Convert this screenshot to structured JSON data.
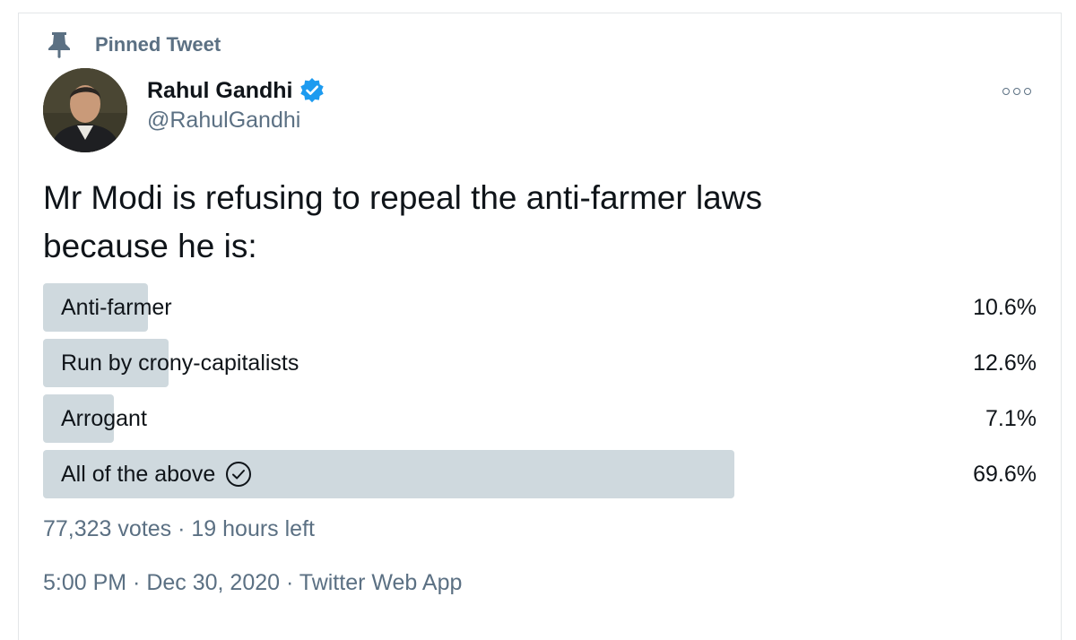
{
  "pinned_label": "Pinned Tweet",
  "author": {
    "name": "Rahul Gandhi",
    "handle": "@RahulGandhi"
  },
  "tweet_text_line1": "Mr Modi is refusing to repeal the anti-farmer laws",
  "tweet_text_line2": "because he is:",
  "poll": {
    "options": [
      {
        "label": "Anti-farmer",
        "percent": "10.6%",
        "fill": 0.106
      },
      {
        "label": "Run by crony-capitalists",
        "percent": "12.6%",
        "fill": 0.126
      },
      {
        "label": "Arrogant",
        "percent": "7.1%",
        "fill": 0.071
      },
      {
        "label": "All of the above",
        "percent": "69.6%",
        "fill": 0.696,
        "selected": true
      }
    ],
    "summary": "77,323 votes · 19 hours left"
  },
  "timestamp": "5:00 PM · Dec 30, 2020 · Twitter Web App",
  "colors": {
    "accent": "#1d9bf0",
    "bar": "#cfd9de",
    "secondary_text": "#5b7083"
  },
  "icons": {
    "pin": "pin-icon",
    "verified": "verified-badge-icon",
    "more": "more-options-icon",
    "check": "check-circle-icon"
  }
}
